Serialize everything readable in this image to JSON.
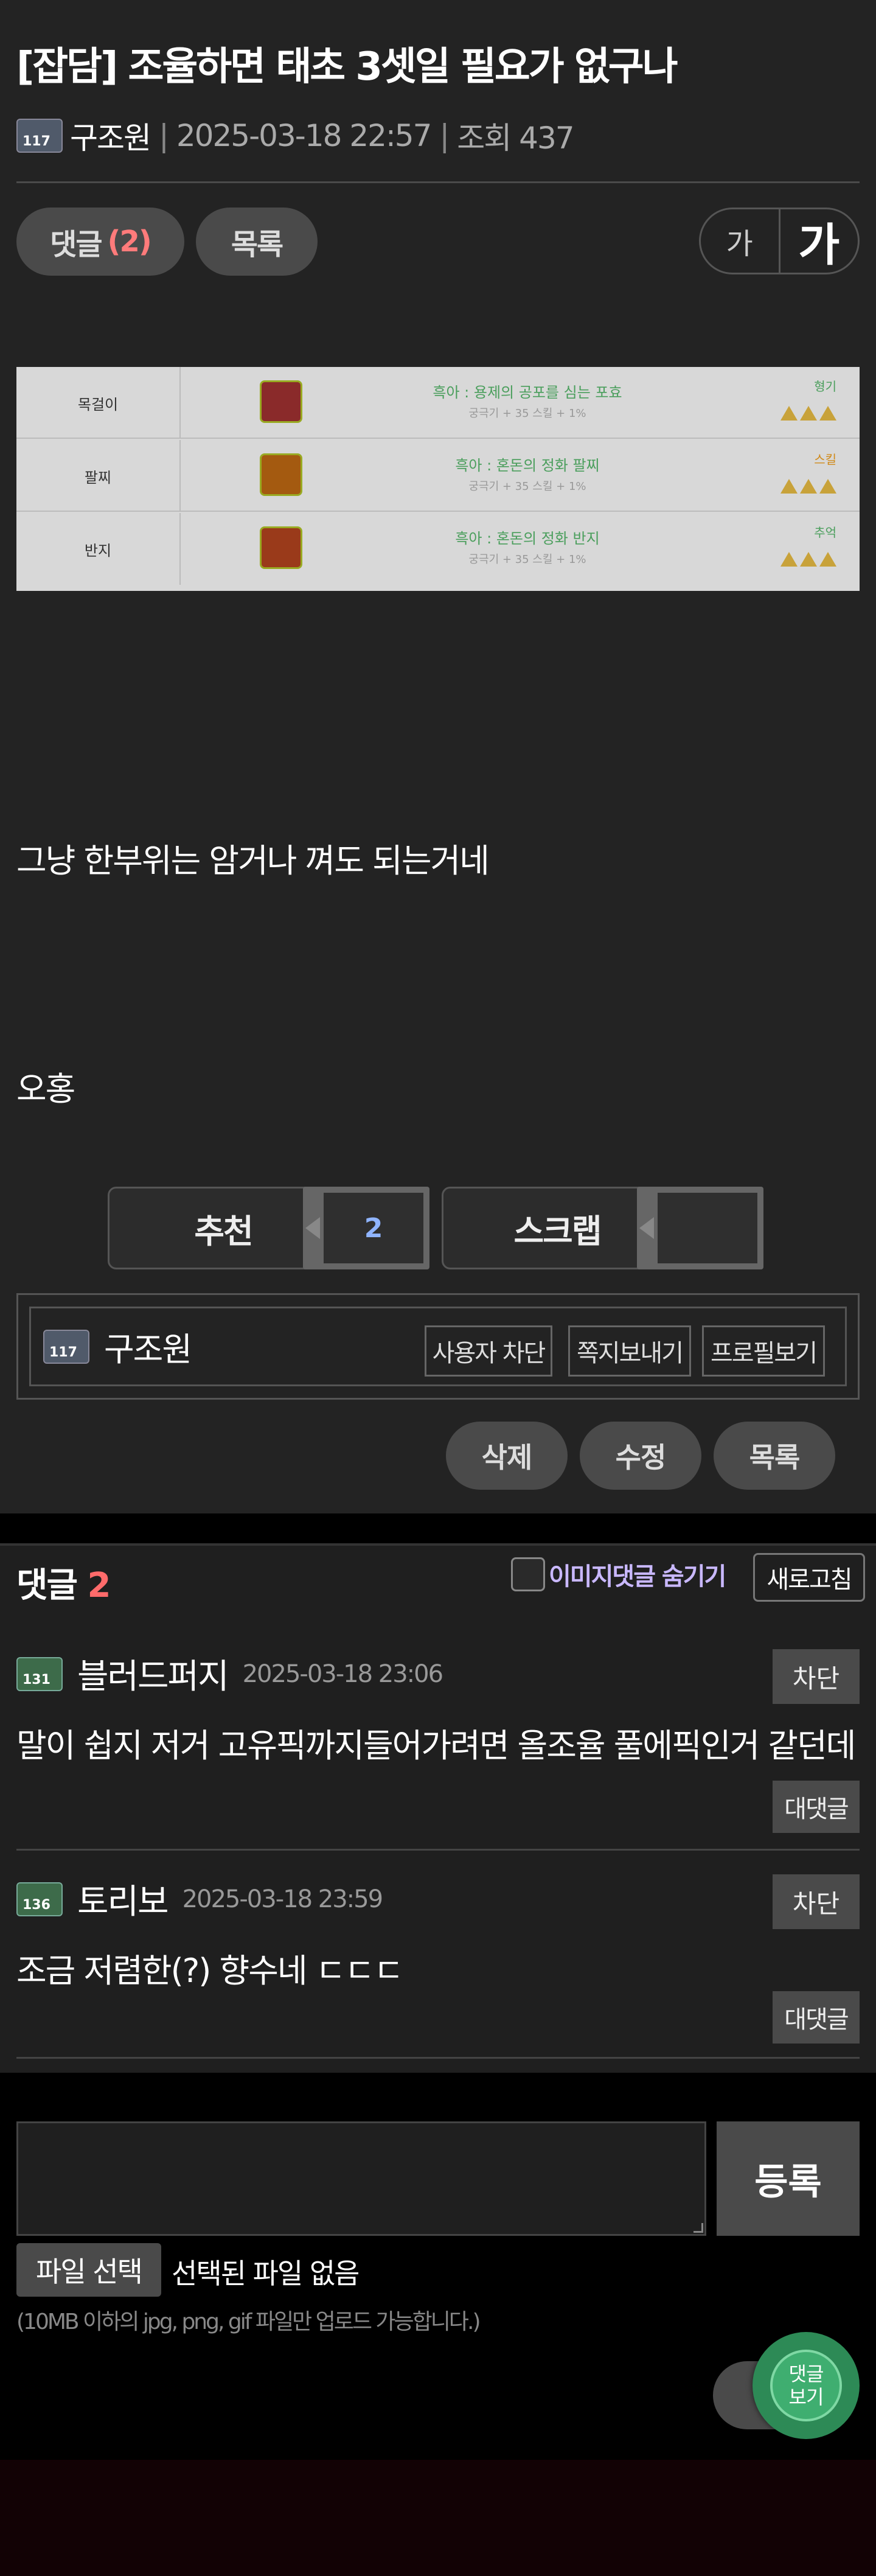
{
  "post": {
    "title": "[잡담] 조율하면 태초 3셋일 필요가 없구나",
    "author": "구조원",
    "author_level": "117",
    "date": "2025-03-18 22:57",
    "views": "조회 437",
    "body_lines": [
      "그냥 한부위는 암거나 껴도 되는거네",
      "오홍"
    ]
  },
  "toolbar": {
    "comments_label": "댓글",
    "comments_count": "(2)",
    "list_label": "목록",
    "font_small": "가",
    "font_big": "가"
  },
  "item_table": {
    "rows": [
      {
        "slot": "목걸이",
        "effect": "흑아 : 용제의 공포를 심는 포효",
        "sub": "궁극기 + 35 스킬 + 1%",
        "tag": "형기",
        "tag_color": "#4a9e5c",
        "icon_color": "#8a2a2a"
      },
      {
        "slot": "팔찌",
        "effect": "흑아 : 혼돈의 정화 팔찌",
        "sub": "궁극기 + 35 스킬 + 1%",
        "tag": "스킬",
        "tag_color": "#d08a1a",
        "icon_color": "#a45a10"
      },
      {
        "slot": "반지",
        "effect": "흑아 : 혼돈의 정화 반지",
        "sub": "궁극기 + 35 스킬 + 1%",
        "tag": "추억",
        "tag_color": "#4a9e5c",
        "icon_color": "#9a3a1a"
      }
    ]
  },
  "vote": {
    "recommend_label": "추천",
    "recommend_count": "2",
    "scrap_label": "스크랩",
    "scrap_count": ""
  },
  "profile": {
    "name": "구조원",
    "level": "117",
    "block_user": "사용자 차단",
    "send_message": "쪽지보내기",
    "view_profile": "프로필보기"
  },
  "actions": {
    "delete": "삭제",
    "edit": "수정",
    "list": "목록"
  },
  "comments": {
    "header_label": "댓글",
    "count": "2",
    "hide_image_label": "이미지댓글 숨기기",
    "refresh_label": "새로고침",
    "items": [
      {
        "name": "블러드퍼지",
        "level": "131",
        "date": "2025-03-18 23:06",
        "text": "말이 쉽지 저거 고유픽까지들어가려면 올조율 풀에픽인거 같던데",
        "block": "차단",
        "reply": "대댓글"
      },
      {
        "name": "토리보",
        "level": "136",
        "date": "2025-03-18 23:59",
        "text": "조금 저렴한(?) 향수네 ㄷㄷㄷ",
        "block": "차단",
        "reply": "대댓글"
      }
    ]
  },
  "write": {
    "submit_label": "등록",
    "file_button": "파일 선택",
    "file_status": "선택된 파일 없음",
    "file_note": "(10MB 이하의 jpg, png, gif 파일만 업로드 가능합니다.)"
  },
  "floating": {
    "view_comments_line1": "댓글",
    "view_comments_line2": "보기"
  }
}
